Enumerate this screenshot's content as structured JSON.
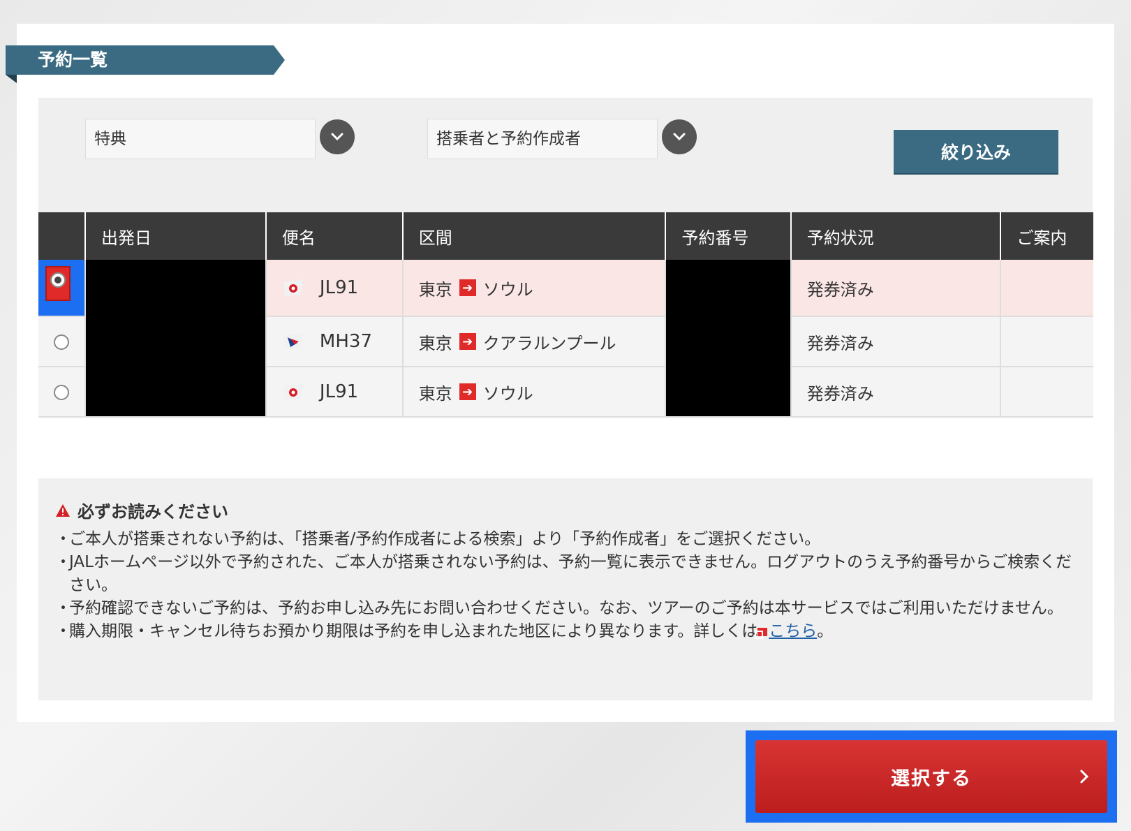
{
  "section": {
    "title": "予約一覧"
  },
  "filters": {
    "type_select": "特典",
    "person_select": "搭乗者と予約作成者",
    "filter_button": "絞り込み"
  },
  "table": {
    "headers": [
      "出発日",
      "便名",
      "区間",
      "予約番号",
      "予約状況",
      "ご案内"
    ],
    "rows": [
      {
        "flight": "JL91",
        "from": "東京",
        "to": "ソウル",
        "status": "発券済み",
        "selected": true
      },
      {
        "flight": "MH37",
        "from": "東京",
        "to": "クアラルンプール",
        "status": "発券済み",
        "selected": false
      },
      {
        "flight": "JL91",
        "from": "東京",
        "to": "ソウル",
        "status": "発券済み",
        "selected": false
      }
    ]
  },
  "notice": {
    "heading": "必ずお読みください",
    "items": [
      "ご本人が搭乗されない予約は、「搭乗者/予約作成者による検索」より「予約作成者」をご選択ください。",
      "JALホームページ以外で予約された、ご本人が搭乗されない予約は、予約一覧に表示できません。ログアウトのうえ予約番号からご検索ください。",
      "予約確認できないご予約は、予約お申し込み先にお問い合わせください。なお、ツアーのご予約は本サービスではご利用いただけません。",
      "購入期限・キャンセル待ちお預かり期限は予約を申し込まれた地区により異なります。詳しくは"
    ],
    "link_text": "こちら",
    "link_suffix": "。"
  },
  "submit": {
    "label": "選択する"
  },
  "colors": {
    "accent": "#3a6b82",
    "brand_red": "#c8202a",
    "highlight": "#1b6ff0"
  }
}
